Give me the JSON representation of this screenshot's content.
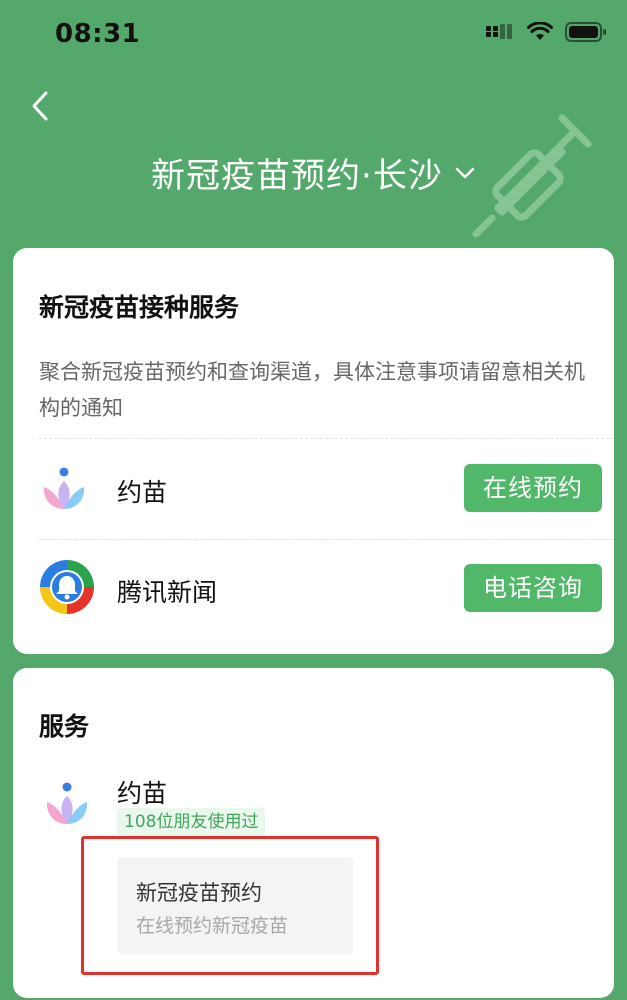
{
  "status": {
    "time": "08:31"
  },
  "header": {
    "title": "新冠疫苗预约·长沙"
  },
  "vaccination_card": {
    "title": "新冠疫苗接种服务",
    "description": "聚合新冠疫苗预约和查询渠道，具体注意事项请留意相关机构的通知",
    "services": [
      {
        "name": "约苗",
        "action": "在线预约",
        "icon": "yuemiao-lotus-icon"
      },
      {
        "name": "腾讯新闻",
        "action": "电话咨询",
        "icon": "tencent-news-icon"
      }
    ]
  },
  "services_card": {
    "title": "服务",
    "app": {
      "name": "约苗",
      "friends_badge": "108位朋友使用过",
      "mini_program": {
        "title": "新冠疫苗预约",
        "subtitle": "在线预约新冠疫苗"
      }
    }
  },
  "colors": {
    "header_bg": "#55a86b",
    "button_green": "#51b86a",
    "highlight_red": "#e0312c"
  }
}
